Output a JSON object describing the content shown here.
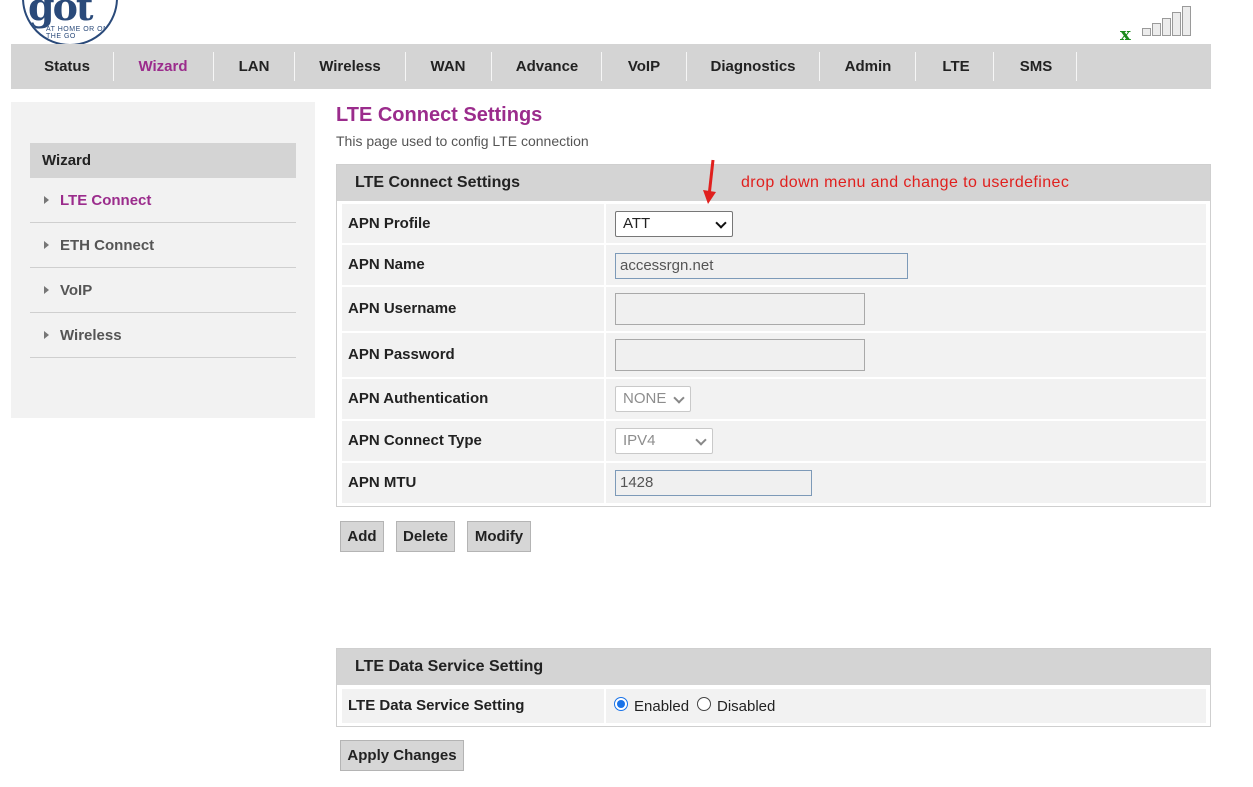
{
  "logo": {
    "text": "got",
    "tagline": "AT HOME OR ON THE GO"
  },
  "signal": {
    "status_mark": "x",
    "icon": "signal-bars-icon",
    "bars_filled": 0,
    "bars_total": 5
  },
  "nav": {
    "items": [
      "Status",
      "Wizard",
      "LAN",
      "Wireless",
      "WAN",
      "Advance",
      "VoIP",
      "Diagnostics",
      "Admin",
      "LTE",
      "SMS"
    ],
    "active": "Wizard"
  },
  "sidebar": {
    "title": "Wizard",
    "items": [
      "LTE Connect",
      "ETH Connect",
      "VoIP",
      "Wireless"
    ],
    "active": "LTE Connect"
  },
  "page": {
    "title": "LTE Connect Settings",
    "description": "This page used to config LTE connection"
  },
  "annotation": {
    "text": "drop down menu and change to userdefinec",
    "icon": "red-arrow-icon"
  },
  "lte_section": {
    "header": "LTE Connect Settings",
    "apn_profile": {
      "label": "APN Profile",
      "value": "ATT"
    },
    "apn_name": {
      "label": "APN Name",
      "value": "accessrgn.net"
    },
    "apn_username": {
      "label": "APN Username",
      "value": ""
    },
    "apn_password": {
      "label": "APN Password",
      "value": ""
    },
    "apn_auth": {
      "label": "APN Authentication",
      "value": "NONE"
    },
    "apn_conn_type": {
      "label": "APN Connect Type",
      "value": "IPV4"
    },
    "apn_mtu": {
      "label": "APN MTU",
      "value": "1428"
    }
  },
  "buttons": {
    "add": "Add",
    "delete": "Delete",
    "modify": "Modify",
    "apply": "Apply Changes"
  },
  "data_section": {
    "header": "LTE Data Service Setting",
    "label": "LTE Data Service Setting",
    "enabled_label": "Enabled",
    "disabled_label": "Disabled",
    "selected": "Enabled"
  },
  "colors": {
    "accent": "#9b2c8c",
    "nav_bg": "#d4d4d4",
    "annotation": "#e0201e",
    "signal_x": "#1a8a1a"
  }
}
